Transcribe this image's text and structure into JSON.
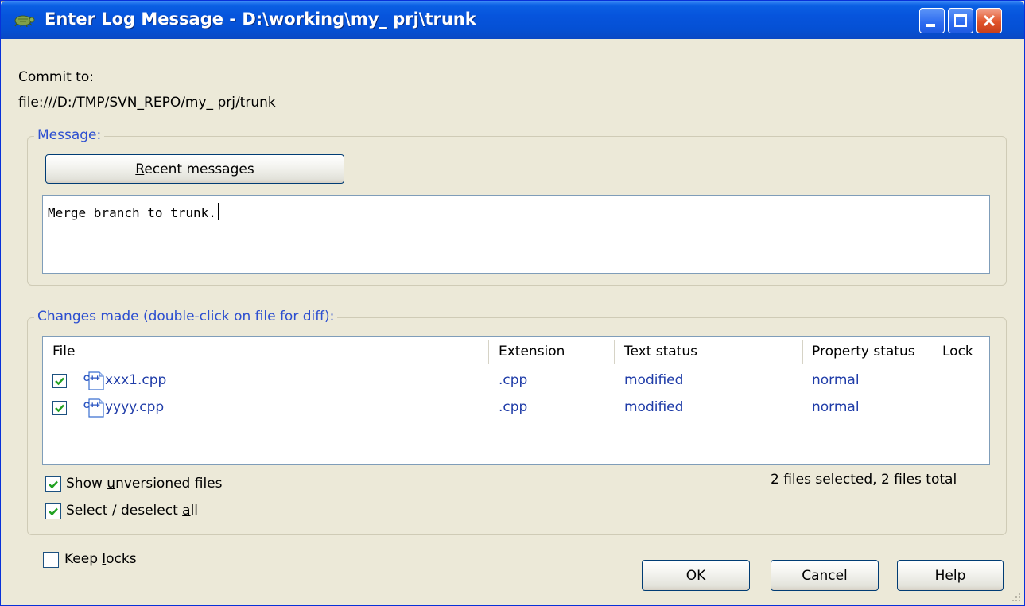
{
  "window": {
    "title": "Enter Log Message - D:\\working\\my_ prj\\trunk",
    "title_bar_color": "#0554d9"
  },
  "commit": {
    "label": "Commit to:",
    "url": "file:///D:/TMP/SVN_REPO/my_ prj/trunk"
  },
  "message_group": {
    "title": "Message:",
    "recent_button": {
      "prefix": "",
      "accel": "R",
      "rest": "ecent messages"
    },
    "text": "Merge branch to trunk."
  },
  "changes_group": {
    "title": "Changes made (double-click on file for diff):",
    "columns": [
      "File",
      "Extension",
      "Text status",
      "Property status",
      "Lock"
    ],
    "rows": [
      {
        "checked": true,
        "icon": "cpp-file-icon",
        "file": "xxx1.cpp",
        "extension": ".cpp",
        "text_status": "modified",
        "property_status": "normal",
        "lock": ""
      },
      {
        "checked": true,
        "icon": "cpp-file-icon",
        "file": "yyyy.cpp",
        "extension": ".cpp",
        "text_status": "modified",
        "property_status": "normal",
        "lock": ""
      }
    ],
    "summary": "2 files selected, 2 files total",
    "show_unversioned": {
      "checked": true,
      "prefix": "Show ",
      "accel": "u",
      "rest": "nversioned files"
    },
    "select_all": {
      "checked": true,
      "prefix": "Select / deselect ",
      "accel": "a",
      "rest": "ll"
    }
  },
  "keep_locks": {
    "checked": false,
    "prefix": "Keep ",
    "accel": "l",
    "rest": "ocks"
  },
  "buttons": {
    "ok": {
      "prefix": "",
      "accel": "O",
      "rest": "K"
    },
    "cancel": {
      "prefix": "",
      "accel": "C",
      "rest": "ancel"
    },
    "help": {
      "prefix": "",
      "accel": "H",
      "rest": "elp"
    }
  },
  "colors": {
    "dialog_bg": "#ece9d8",
    "group_title": "#2d4fd0",
    "list_text": "#1f3ca8",
    "check_mark": "#21a121"
  }
}
